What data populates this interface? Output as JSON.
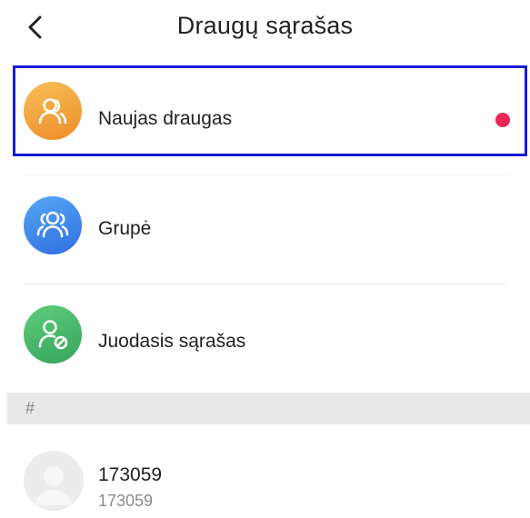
{
  "header": {
    "title": "Draugų sąrašas"
  },
  "menu": [
    {
      "label": "Naujas draugas",
      "color": "#f2a33b",
      "icon": "users-icon",
      "badge": true
    },
    {
      "label": "Grupė",
      "color": "#3d8ef0",
      "icon": "group-icon",
      "badge": false
    },
    {
      "label": "Juodasis sąrašas",
      "color": "#47b86a",
      "icon": "blocked-user-icon",
      "badge": false
    }
  ],
  "section": {
    "header": "#"
  },
  "contacts": [
    {
      "name": "173059",
      "id": "173059"
    }
  ]
}
